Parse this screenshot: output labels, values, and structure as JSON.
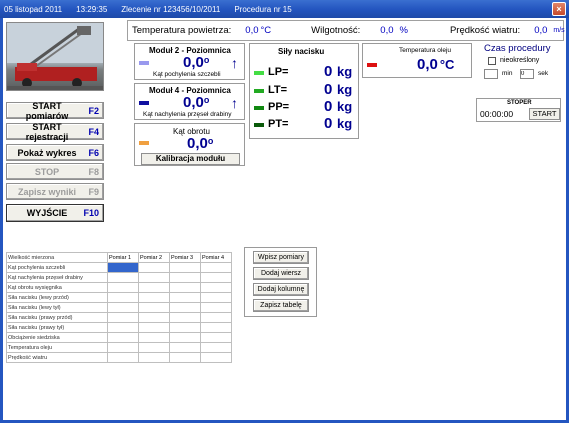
{
  "titlebar": {
    "date": "05 listopad 2011",
    "time": "13:29:35",
    "order": "Zlecenie nr 123456/10/2011",
    "procedure": "Procedura nr 15"
  },
  "header": {
    "air_temp_label": "Temperatura powietrza:",
    "air_temp_value": "0,0",
    "air_temp_unit": "°C",
    "humidity_label": "Wilgotność:",
    "humidity_value": "0,0",
    "humidity_unit": "%",
    "wind_label": "Prędkość wiatru:",
    "wind_value": "0,0",
    "wind_unit": "m/s"
  },
  "buttons": {
    "start_measure": "START pomiarów",
    "start_measure_key": "F2",
    "start_register": "START rejestracji",
    "start_register_key": "F4",
    "show_chart": "Pokaż wykres",
    "show_chart_key": "F6",
    "stop": "STOP",
    "stop_key": "F8",
    "save_results": "Zapisz wyniki",
    "save_results_key": "F9",
    "exit": "WYJŚCIE",
    "exit_key": "F10"
  },
  "module2": {
    "title": "Moduł 2 - Poziomnica",
    "value": "0,0",
    "unit": "o",
    "caption": "Kąt pochylenia szczebli",
    "color": "#9999ee"
  },
  "module4": {
    "title": "Moduł 4 - Poziomnica",
    "value": "0,0",
    "unit": "o",
    "caption": "Kąt nachylenia przęseł drabiny",
    "color": "#1010a0"
  },
  "rotation": {
    "title": "Kąt obrotu",
    "value": "0,0",
    "unit": "o",
    "calibrate": "Kalibracja modułu",
    "color": "#f0a040"
  },
  "forces": {
    "title": "Siły nacisku",
    "items": [
      {
        "label": "LP=",
        "value": "0",
        "unit": "kg",
        "color": "#44dd44"
      },
      {
        "label": "LT=",
        "value": "0",
        "unit": "kg",
        "color": "#22aa22"
      },
      {
        "label": "PP=",
        "value": "0",
        "unit": "kg",
        "color": "#118811"
      },
      {
        "label": "PT=",
        "value": "0",
        "unit": "kg",
        "color": "#0a5a0a"
      }
    ]
  },
  "oil": {
    "title": "Temperatura oleju",
    "value": "0,0",
    "unit": "°C",
    "color": "#dd1111"
  },
  "procedure_time": {
    "title": "Czas procedury",
    "unlimited_label": "nieokreślony",
    "min_value": "",
    "min_label": "min",
    "sec_value": "0",
    "sec_label": "sek"
  },
  "stopwatch": {
    "title": "STOPER",
    "value": "00:00:00",
    "start": "START"
  },
  "table": {
    "header_label": "Wielkość mierzona",
    "columns": [
      "Pomiar 1",
      "Pomiar 2",
      "Pomiar 3",
      "Pomiar 4"
    ],
    "rows": [
      "Kąt pochylenia szczebli",
      "Kąt nachylenia przęseł drabiny",
      "Kąt obrotu wysięgnika",
      "Siła nacisku (lewy przód)",
      "Siła nacisku (lewy tył)",
      "Siła nacisku (prawy przód)",
      "Siła nacisku (prawy tył)",
      "Obciążenie siedziska",
      "Temperatura oleju",
      "Prędkość wiatru"
    ]
  },
  "side_buttons": {
    "write_measure": "Wpisz pomiary",
    "add_row": "Dodaj wiersz",
    "add_column": "Dodaj kolumnę",
    "save_table": "Zapisz tabelę"
  }
}
